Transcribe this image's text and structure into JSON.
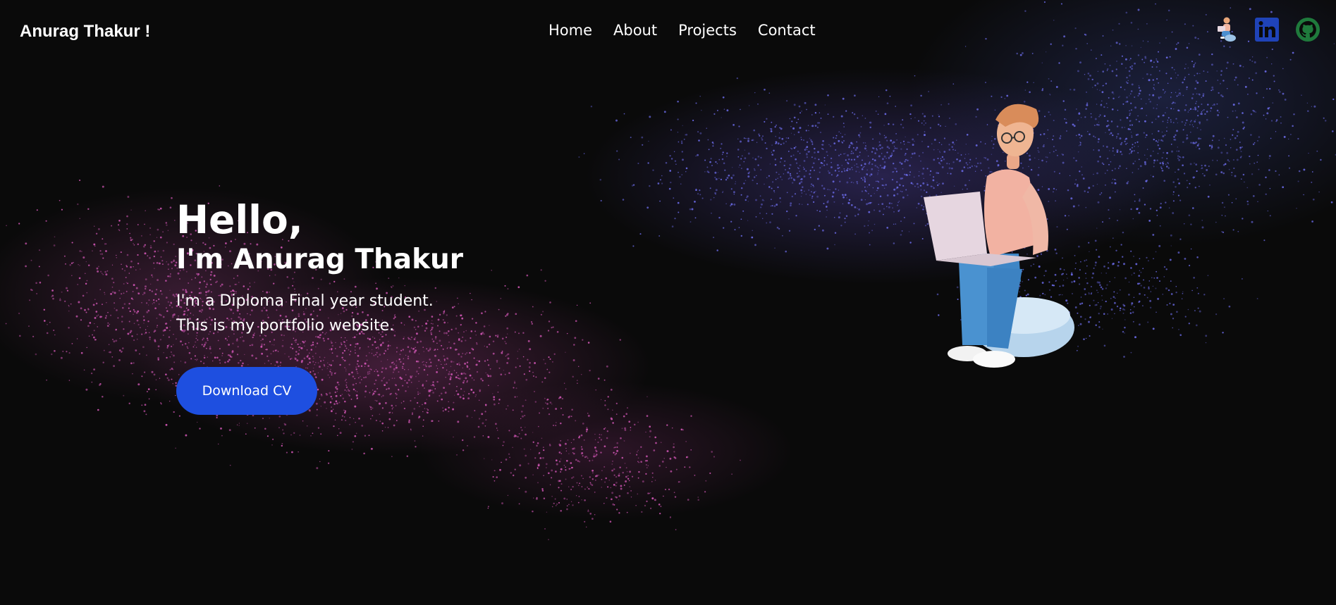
{
  "navbar": {
    "brand": "Anurag Thakur !",
    "links": [
      "Home",
      "About",
      "Projects",
      "Contact"
    ],
    "social": [
      {
        "icon": "avatar-icon"
      },
      {
        "icon": "linkedin-icon"
      },
      {
        "icon": "github-icon"
      }
    ]
  },
  "hero": {
    "greeting": "Hello,",
    "name": "I'm Anurag Thakur",
    "line1": "I'm a Diploma Final year student.",
    "line2": "This is my portfolio website.",
    "cta_label": "Download CV"
  },
  "colors": {
    "background": "#0a0a0a",
    "button": "#1e4fe0",
    "text": "#ffffff",
    "linkedin": "#1f43b8",
    "github": "#1f7a3c",
    "particles_pink": "#d056b4",
    "particles_blue": "#6a6ae6"
  }
}
